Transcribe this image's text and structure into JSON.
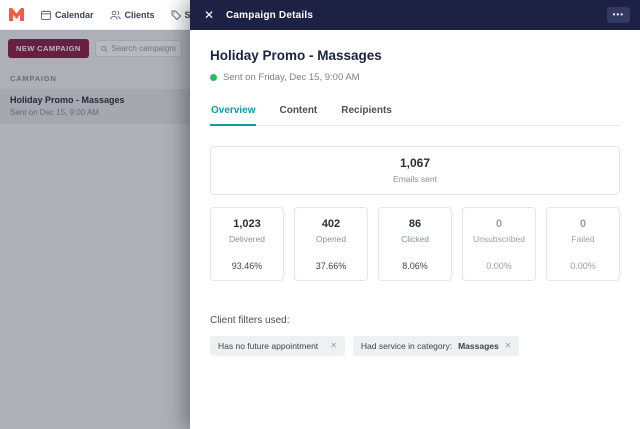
{
  "nav": {
    "items": [
      {
        "label": "Calendar"
      },
      {
        "label": "Clients"
      },
      {
        "label": "Sales"
      }
    ]
  },
  "sidebar": {
    "new_campaign_button": "NEW CAMPAIGN",
    "search_placeholder": "Search campaigns",
    "section_label": "CAMPAIGN",
    "items": [
      {
        "title": "Holiday Promo - Massages",
        "subtitle": "Sent on Dec 15, 9:00 AM"
      }
    ]
  },
  "panel": {
    "header": {
      "title": "Campaign Details",
      "more_label": "•••",
      "close_label": "✕"
    },
    "campaign_title": "Holiday Promo - Massages",
    "status_text": "Sent on Friday, Dec 15, 9:00 AM",
    "tabs": [
      {
        "label": "Overview"
      },
      {
        "label": "Content"
      },
      {
        "label": "Recipients"
      }
    ],
    "summary": {
      "value": "1,067",
      "label": "Emails sent"
    },
    "stats": [
      {
        "value": "1,023",
        "label": "Delivered",
        "percent": "93.46%"
      },
      {
        "value": "402",
        "label": "Opened",
        "percent": "37.66%"
      },
      {
        "value": "86",
        "label": "Clicked",
        "percent": "8.06%"
      },
      {
        "value": "0",
        "label": "Unsubscribed",
        "percent": "0.00%"
      },
      {
        "value": "0",
        "label": "Failed",
        "percent": "0.00%"
      }
    ],
    "filters": {
      "label": "Client filters used:",
      "chips": [
        {
          "text": "Has no future appointment",
          "bold": "",
          "remove": "✕"
        },
        {
          "text": "Had service in category: ",
          "bold": "Massages",
          "remove": "✕"
        }
      ]
    }
  },
  "colors": {
    "header_navy": "#1d2244",
    "accent_teal": "#0b9ea4",
    "brand_coral": "#f05c44",
    "button_maroon": "#8d2450",
    "status_green": "#2eb868"
  }
}
